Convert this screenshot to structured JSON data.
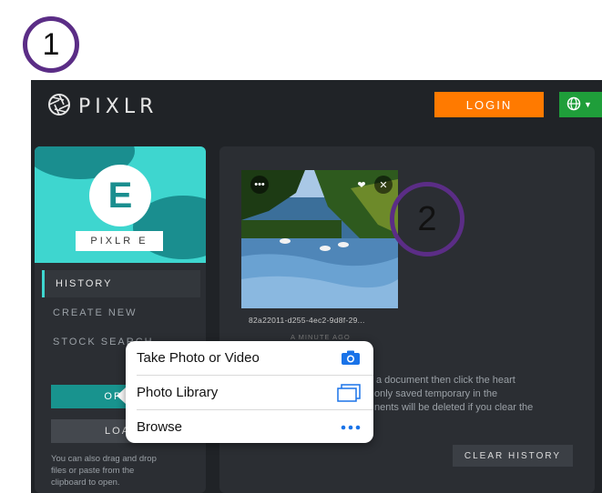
{
  "badges": {
    "one": "1",
    "two": "2"
  },
  "header": {
    "logo_text": "PIXLR",
    "login_label": "LOGIN",
    "lang_icon": "globe-icon"
  },
  "sidebar": {
    "product_label": "PIXLR E",
    "hero_letter": "E",
    "nav": [
      {
        "label": "HISTORY",
        "active": true
      },
      {
        "label": "CREATE NEW",
        "active": false
      },
      {
        "label": "STOCK SEARCH",
        "active": false
      }
    ],
    "open_label": "OPEN",
    "load_label": "LOAD",
    "help_text_lines": [
      "You can also drag and drop",
      "files or paste from the",
      "clipboard to open."
    ]
  },
  "history": {
    "item_name": "82a22011-d255-4ec2-9d8f-29...",
    "item_time": "A MINUTE AGO",
    "info_lines": [
      "a document then click the heart",
      "only saved temporary in the",
      "nents will be deleted if you clear the"
    ],
    "clear_label": "CLEAR HISTORY"
  },
  "popover": {
    "items": [
      {
        "label": "Take Photo or Video",
        "icon": "camera-icon"
      },
      {
        "label": "Photo Library",
        "icon": "photo-library-icon"
      },
      {
        "label": "Browse",
        "icon": "more-dots-icon"
      }
    ]
  },
  "colors": {
    "accent_orange": "#ff7a00",
    "accent_teal": "#3ed6cf",
    "lang_green": "#1f9e3a",
    "badge_purple": "#5b2d86",
    "ios_blue": "#1a73e8"
  }
}
